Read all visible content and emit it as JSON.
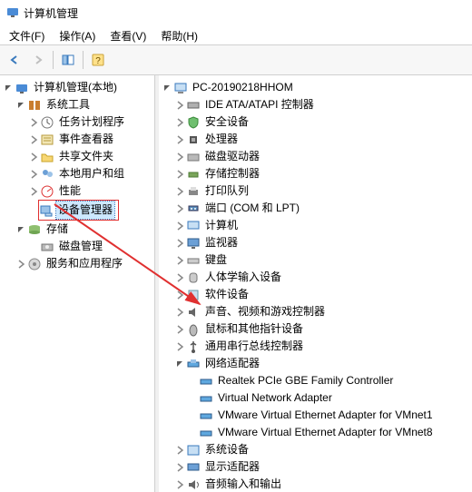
{
  "window": {
    "title": "计算机管理"
  },
  "menu": {
    "file": "文件(F)",
    "action": "操作(A)",
    "view": "查看(V)",
    "help": "帮助(H)"
  },
  "left_tree": {
    "root": "计算机管理(本地)",
    "sys_tools": "系统工具",
    "task_sched": "任务计划程序",
    "event_viewer": "事件查看器",
    "shared": "共享文件夹",
    "local_users": "本地用户和组",
    "perf": "性能",
    "dev_mgr": "设备管理器",
    "storage": "存储",
    "disk_mgmt": "磁盘管理",
    "svc_apps": "服务和应用程序"
  },
  "right_tree": {
    "computer": "PC-20190218HHOM",
    "ide": "IDE ATA/ATAPI 控制器",
    "security": "安全设备",
    "cpu": "处理器",
    "diskdrive": "磁盘驱动器",
    "storagectl": "存储控制器",
    "printq": "打印队列",
    "ports": "端口 (COM 和 LPT)",
    "computers": "计算机",
    "monitor": "监视器",
    "keyboard": "键盘",
    "hid": "人体学输入设备",
    "software": "软件设备",
    "sound": "声音、视频和游戏控制器",
    "mouse": "鼠标和其他指针设备",
    "usb": "通用串行总线控制器",
    "netadapt": "网络适配器",
    "net_realtek": "Realtek PCIe GBE Family Controller",
    "net_virtual": "Virtual Network Adapter",
    "net_vmnet1": "VMware Virtual Ethernet Adapter for VMnet1",
    "net_vmnet8": "VMware Virtual Ethernet Adapter for VMnet8",
    "system": "系统设备",
    "display": "显示适配器",
    "audioio": "音频输入和输出"
  }
}
